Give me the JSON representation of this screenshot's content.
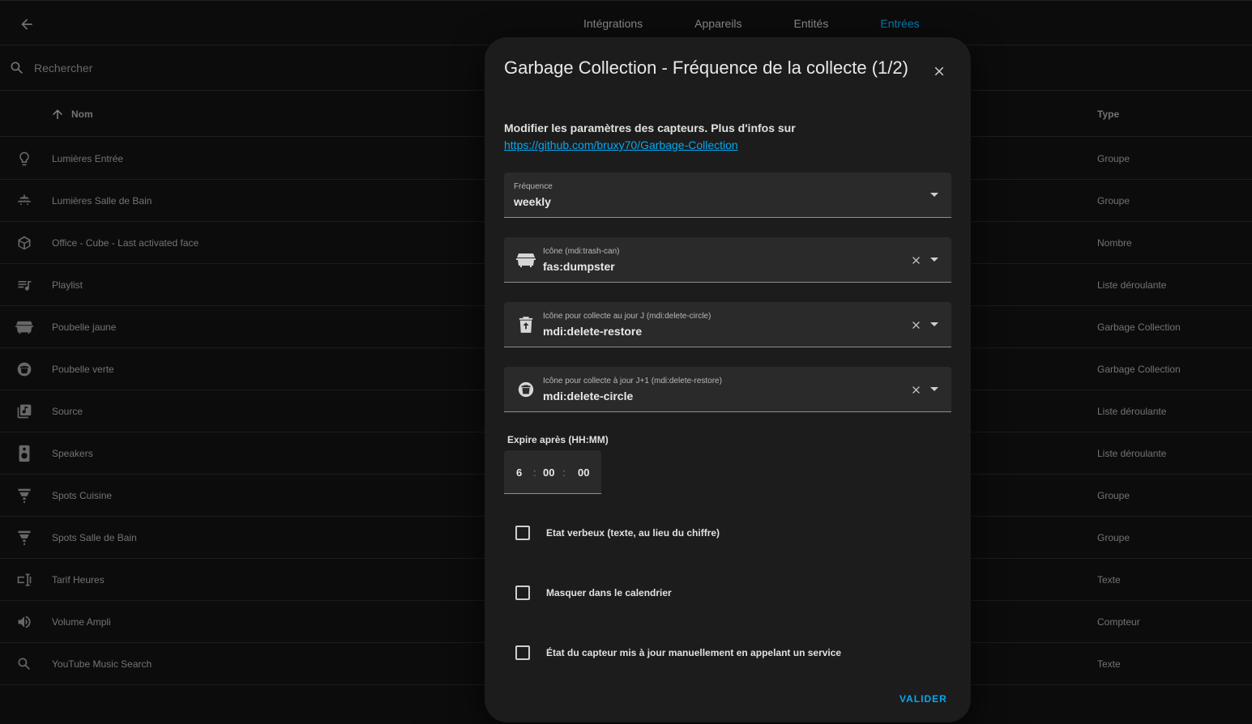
{
  "header": {
    "tabs": [
      {
        "label": "Intégrations",
        "active": false
      },
      {
        "label": "Appareils",
        "active": false
      },
      {
        "label": "Entités",
        "active": false
      },
      {
        "label": "Entrées",
        "active": true
      }
    ],
    "accent_color": "#03a9f4"
  },
  "search": {
    "placeholder": "Rechercher",
    "value": ""
  },
  "table": {
    "sort_icon": "arrow-up-icon",
    "col_name": "Nom",
    "col_type": "Type",
    "rows": [
      {
        "icon": "lightbulb-outline-icon",
        "name": "Lumières Entrée",
        "type": "Groupe"
      },
      {
        "icon": "ceiling-light-multiple-icon",
        "name": "Lumières Salle de Bain",
        "type": "Groupe"
      },
      {
        "icon": "cube-outline-icon",
        "name": "Office - Cube - Last activated face",
        "type": "Nombre"
      },
      {
        "icon": "playlist-music-icon",
        "name": "Playlist",
        "type": "Liste déroulante"
      },
      {
        "icon": "dumpster-icon",
        "name": "Poubelle jaune",
        "type": "Garbage Collection"
      },
      {
        "icon": "delete-circle-icon",
        "name": "Poubelle verte",
        "type": "Garbage Collection"
      },
      {
        "icon": "music-box-multiple-icon",
        "name": "Source",
        "type": "Liste déroulante"
      },
      {
        "icon": "speaker-icon",
        "name": "Speakers",
        "type": "Liste déroulante"
      },
      {
        "icon": "spotlight-icon",
        "name": "Spots Cuisine",
        "type": "Groupe"
      },
      {
        "icon": "spotlight-icon",
        "name": "Spots Salle de Bain",
        "type": "Groupe"
      },
      {
        "icon": "form-textbox-icon",
        "name": "Tarif Heures",
        "type": "Texte"
      },
      {
        "icon": "volume-high-icon",
        "name": "Volume Ampli",
        "type": "Compteur"
      },
      {
        "icon": "magnify-icon",
        "name": "YouTube Music Search",
        "type": "Texte"
      }
    ]
  },
  "dialog": {
    "title": "Garbage Collection - Fréquence de la collecte (1/2)",
    "description": "Modifier les paramètres des capteurs. Plus d'infos sur",
    "link": "https://github.com/bruxy70/Garbage-Collection",
    "fields": {
      "frequency": {
        "label": "Fréquence",
        "value": "weekly"
      },
      "icon": {
        "label": "Icône (mdi:trash-can)",
        "value": "fas:dumpster",
        "icon": "dumpster-icon"
      },
      "icon_today": {
        "label": "Icône pour collecte au jour J (mdi:delete-circle)",
        "value": "mdi:delete-restore",
        "icon": "delete-restore-icon"
      },
      "icon_tomorrow": {
        "label": "Icône pour collecte à jour J+1 (mdi:delete-restore)",
        "value": "mdi:delete-circle",
        "icon": "delete-circle-icon"
      }
    },
    "expire": {
      "label": "Expire après (HH:MM)",
      "hours": "6",
      "minutes": "00",
      "seconds": "00",
      "separator": ":"
    },
    "checkboxes": [
      {
        "label": "Etat verbeux (texte, au lieu du chiffre)",
        "checked": false
      },
      {
        "label": "Masquer dans le calendrier",
        "checked": false
      },
      {
        "label": "État du capteur mis à jour manuellement en appelant un service",
        "checked": false
      }
    ],
    "submit": "VALIDER"
  }
}
